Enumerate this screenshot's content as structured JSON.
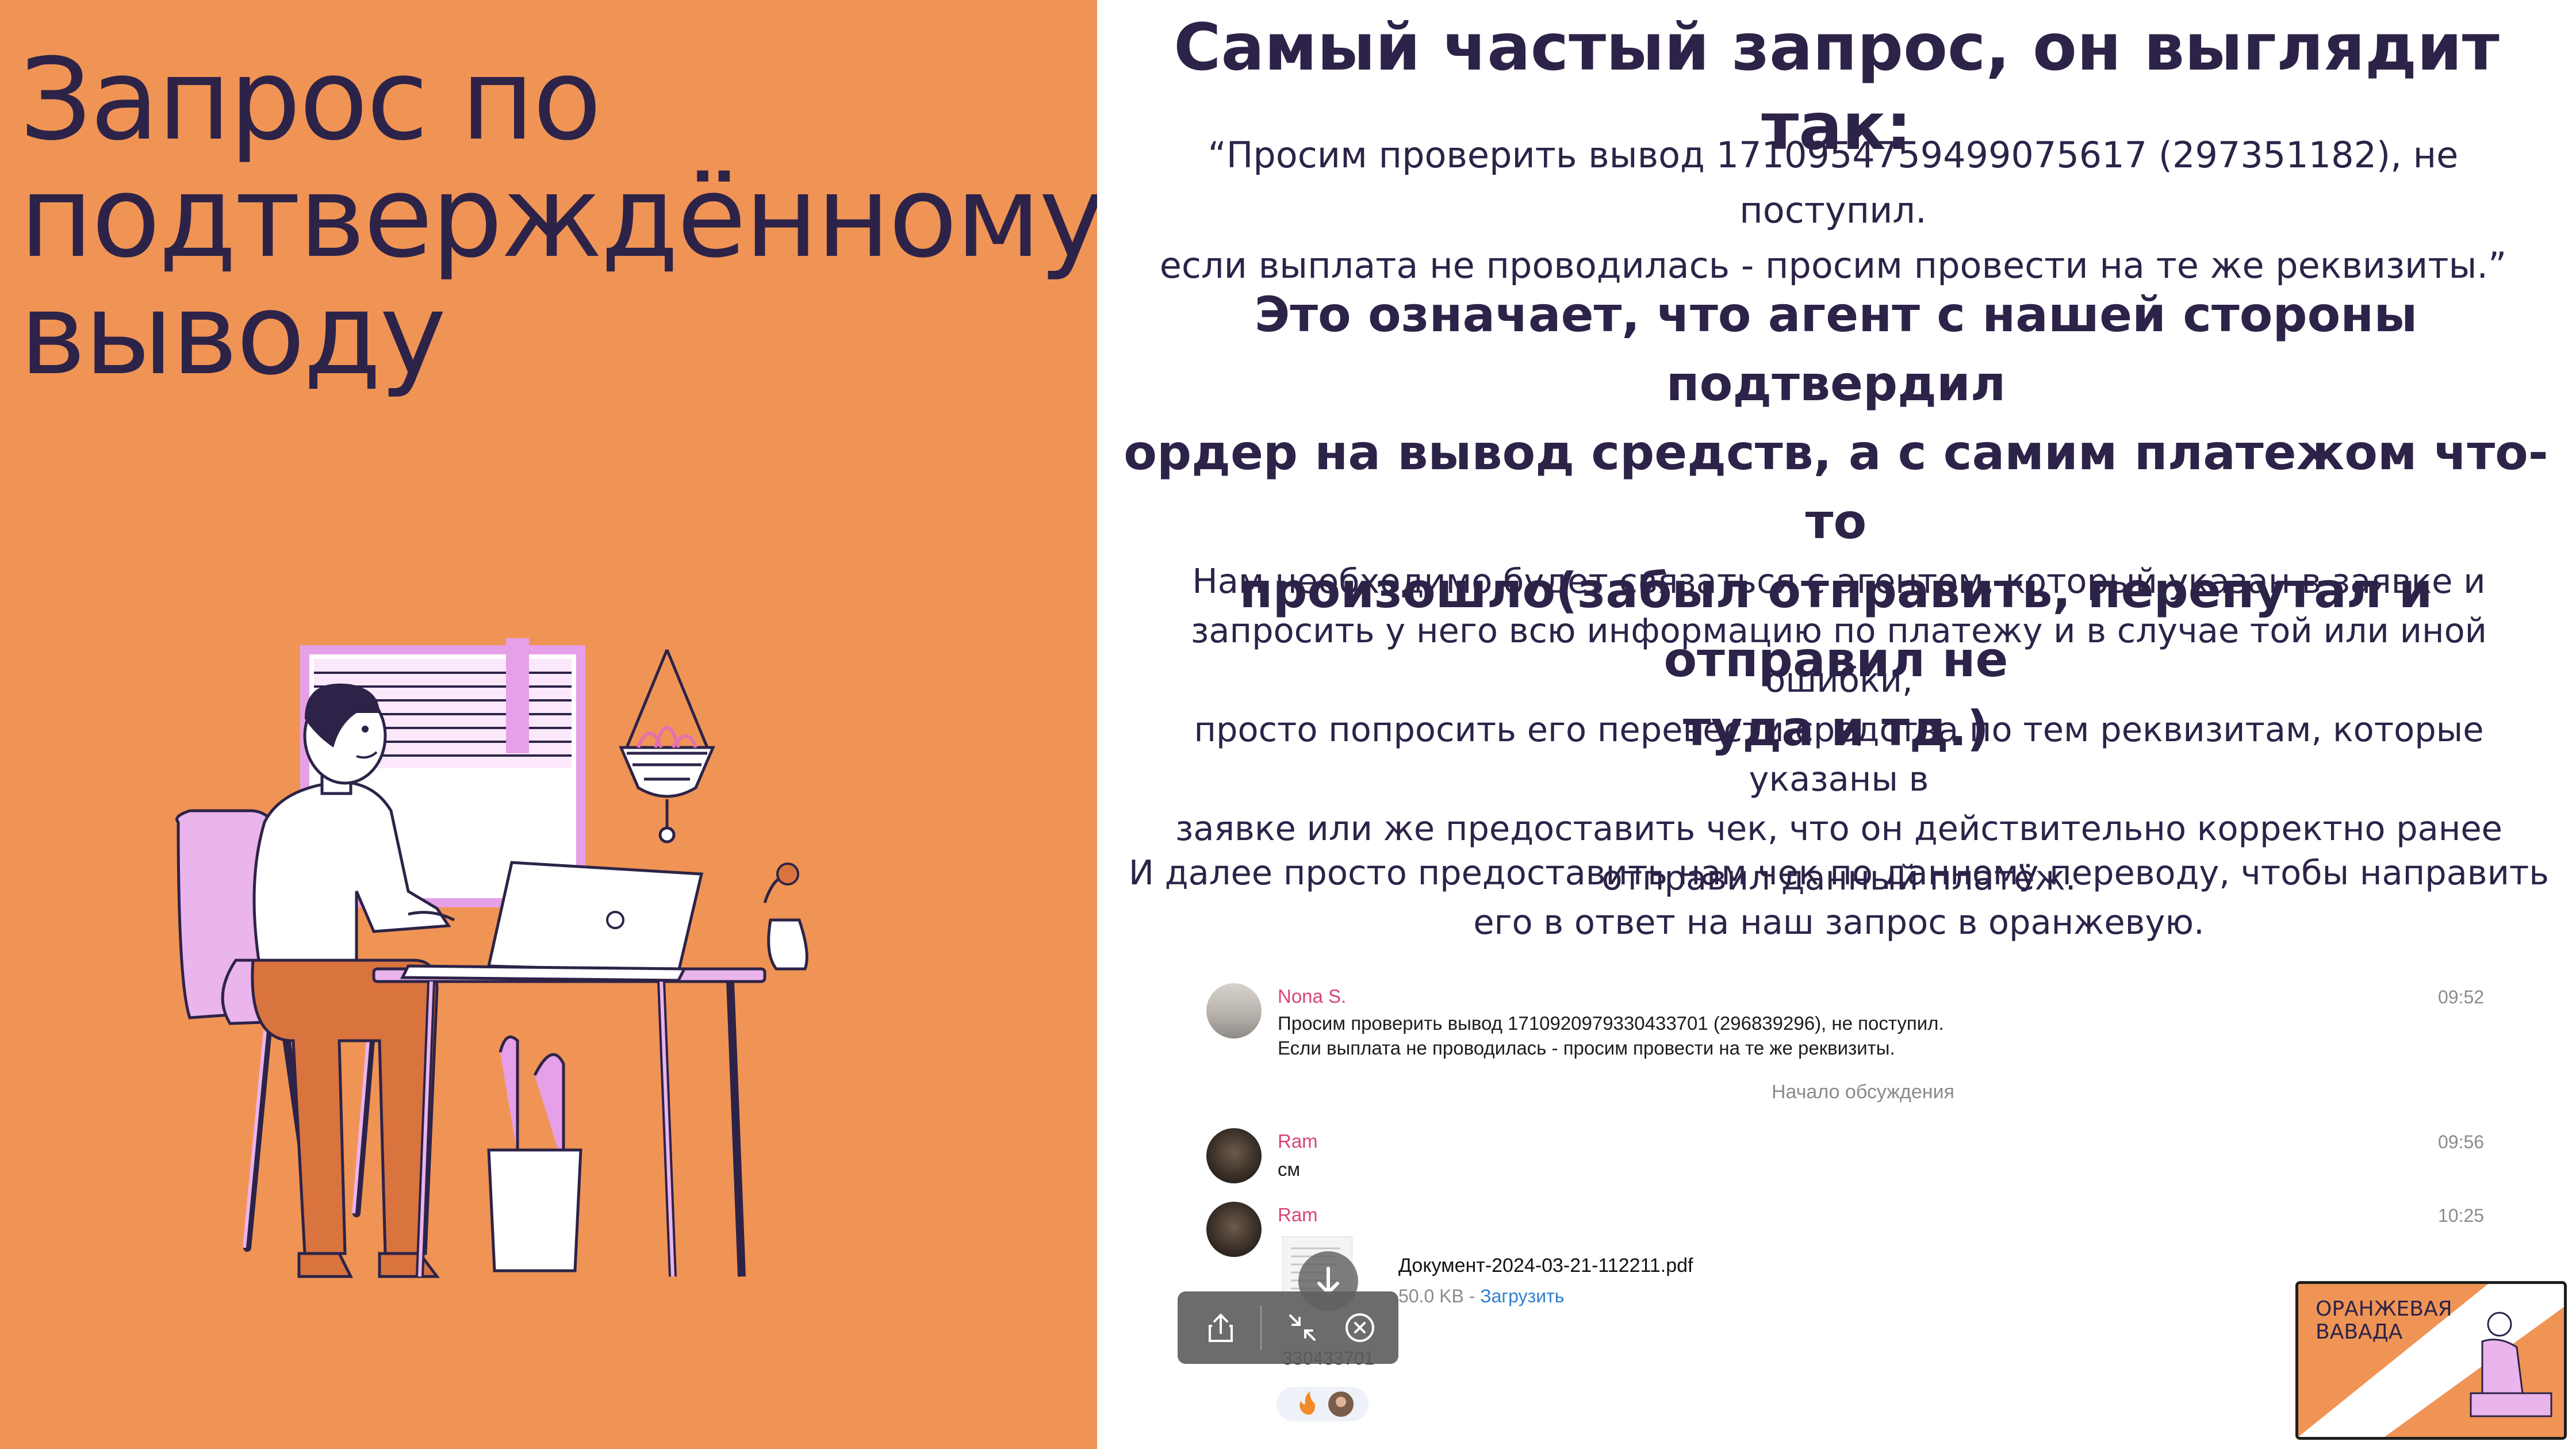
{
  "left": {
    "title_lines": [
      "Запрос по",
      "подтверждённому",
      "выводу"
    ]
  },
  "right": {
    "heading": "Самый частый запрос, он выглядит так:",
    "quote_lines": [
      "“Просим проверить вывод 1710954759499075617 (297351182), не поступил.",
      "если выплата не проводилась - просим провести на те же реквизиты.”"
    ],
    "meaning_lines": [
      "Это означает, что агент с нашей стороны подтвердил",
      "ордер на вывод средств, а с самим платежом что-то",
      "произошло(забыл отправить, перепутал и отправил не",
      "туда и тд.)"
    ],
    "explanation_lines": [
      "Нам необходимо будет связаться с агентом, который указан в заявке и",
      "запросить у него всю информацию по платежу и в случае той или иной ошибки,",
      "просто попросить его перевести средства по тем реквизитам, которые указаны в",
      "заявке или же предоставить чек, что он действительно корректно ранее",
      "отправил данный платёж."
    ],
    "further_lines": [
      "И далее просто предоставить нам чек по данному переводу, чтобы направить",
      "его в ответ на наш запрос в оранжевую."
    ]
  },
  "chat": {
    "messages": [
      {
        "author": "Nona S.",
        "time": "09:52",
        "lines": [
          "Просим проверить вывод 1710920979330433701 (296839296), не поступил.",
          "Если выплата не проводилась -  просим провести на те же реквизиты."
        ]
      },
      {
        "author": "Ram",
        "time": "09:56",
        "lines": [
          "см"
        ]
      },
      {
        "author": "Ram",
        "time": "10:25",
        "lines": []
      }
    ],
    "discussion_label": "Начало обсуждения",
    "document": {
      "name": "Документ-2024-03-21-112211.pdf",
      "size": "50.0 KB",
      "separator": " - ",
      "download_label": "Загрузить"
    },
    "message_id_fragment": "330433701",
    "toolbar": {
      "icons": [
        "share-icon",
        "collapse-icon",
        "close-circle-icon"
      ]
    }
  },
  "logo": {
    "lines": [
      "ОРАНЖЕВАЯ",
      "ВАВАДА"
    ]
  },
  "colors": {
    "orange": "#f09455",
    "text_dark": "#2d2348",
    "chair_pink": "#eab4ec",
    "pants": "#d9743f",
    "author_pink": "#d9447a",
    "link_blue": "#2f7fd4"
  }
}
